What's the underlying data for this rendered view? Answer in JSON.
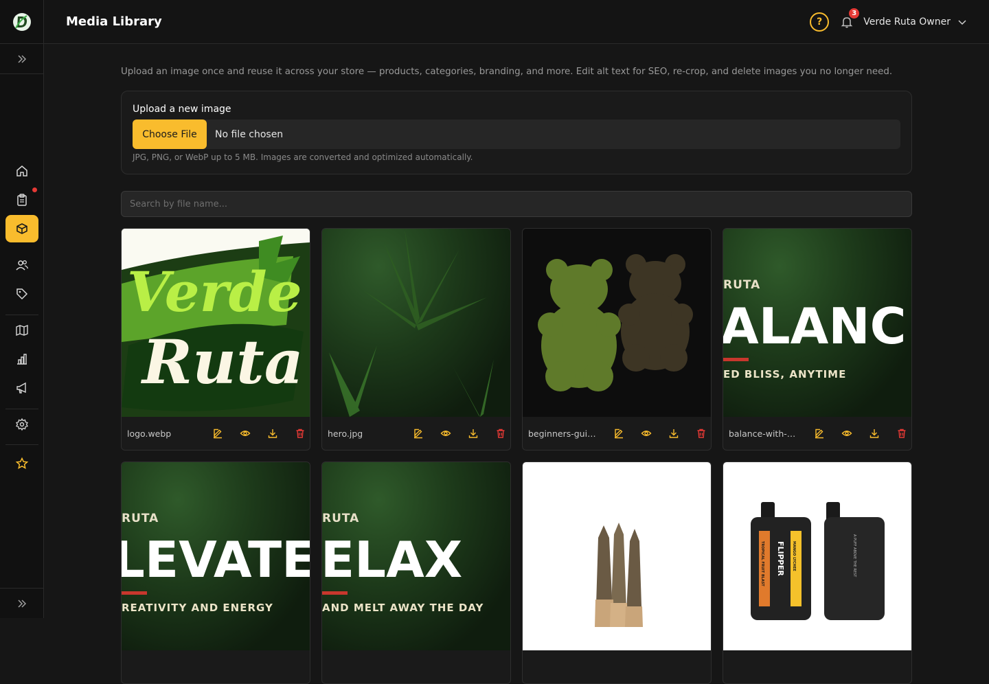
{
  "app": {
    "title": "Media Library"
  },
  "header": {
    "user_name": "Verde Ruta Owner",
    "notification_count": "3",
    "help_symbol": "?"
  },
  "page": {
    "intro": "Upload an image once and reuse it across your store — products, categories, branding, and more. Edit alt text for SEO, re-crop, and delete images you no longer need.",
    "upload": {
      "label": "Upload a new image",
      "choose_button": "Choose File",
      "no_file": "No file chosen",
      "hint": "JPG, PNG, or WebP up to 5 MB. Images are converted and optimized automatically."
    },
    "search": {
      "placeholder": "Search by file name..."
    }
  },
  "sidebar": {
    "items": [
      {
        "icon": "home-icon",
        "active": false
      },
      {
        "icon": "clipboard-icon",
        "active": false,
        "has_dot": true
      },
      {
        "icon": "box-icon",
        "active": true
      },
      {
        "icon": "users-icon",
        "active": false
      },
      {
        "icon": "tag-icon",
        "active": false
      },
      {
        "icon": "map-icon",
        "active": false
      },
      {
        "icon": "bar-chart-icon",
        "active": false
      },
      {
        "icon": "megaphone-icon",
        "active": false
      },
      {
        "icon": "gear-icon",
        "active": false
      },
      {
        "icon": "star-icon",
        "active": false
      }
    ]
  },
  "media": [
    {
      "filename": "logo.webp",
      "logo_line1": "Verde",
      "logo_line2": "Ruta"
    },
    {
      "filename": "hero.jpg"
    },
    {
      "filename": "beginners-guid..."
    },
    {
      "filename": "balance-with-hy...",
      "banner_small": "RUTA",
      "banner_big": "ALANC",
      "banner_sub": "ED BLISS, ANYTIME"
    },
    {
      "filename": "",
      "banner_small": "RUTA",
      "banner_big": "LEVATE",
      "banner_sub": "REATIVITY AND ENERGY"
    },
    {
      "filename": "",
      "banner_small": "RUTA",
      "banner_big": "ELAX",
      "banner_sub": "AND MELT AWAY THE DAY"
    },
    {
      "filename": ""
    },
    {
      "filename": "",
      "product_text1": "FLIPPER",
      "product_text2": "MANGO LYCHEE",
      "product_text3": "TROPICAL FRUIT BLAST",
      "product_text4": "A PUFF ABOVE THE REST"
    }
  ],
  "colors": {
    "accent": "#f9bc2d",
    "danger": "#e53935",
    "bg": "#161616"
  }
}
